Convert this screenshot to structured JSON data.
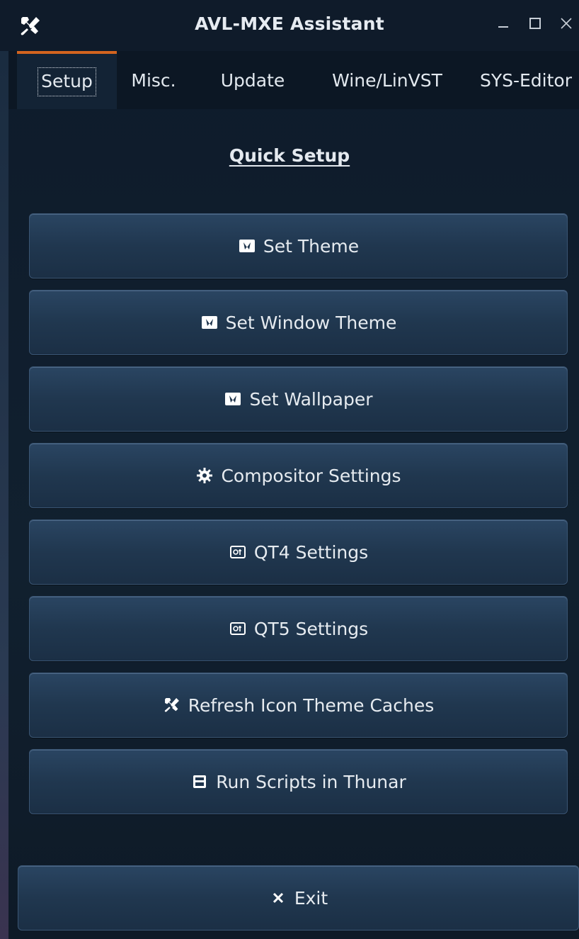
{
  "window": {
    "title": "AVL-MXE Assistant",
    "app_icon": "tools-icon",
    "controls": {
      "minimize_icon": "minimize-icon",
      "maximize_icon": "maximize-icon",
      "close_icon": "close-icon"
    }
  },
  "tabs": [
    {
      "label": "Setup",
      "active": true
    },
    {
      "label": "Misc.",
      "active": false
    },
    {
      "label": "Update",
      "active": false
    },
    {
      "label": "Wine/LinVST",
      "active": false
    },
    {
      "label": "SYS-Editor",
      "active": false
    }
  ],
  "main": {
    "section_title": "Quick Setup",
    "buttons": [
      {
        "label": "Set Theme",
        "icon": "theme-icon"
      },
      {
        "label": "Set Window Theme",
        "icon": "theme-icon"
      },
      {
        "label": "Set Wallpaper",
        "icon": "theme-icon"
      },
      {
        "label": "Compositor Settings",
        "icon": "gear-icon"
      },
      {
        "label": "QT4 Settings",
        "icon": "qt-icon"
      },
      {
        "label": "QT5 Settings",
        "icon": "qt-icon"
      },
      {
        "label": "Refresh Icon Theme Caches",
        "icon": "tools-icon"
      },
      {
        "label": "Run Scripts in Thunar",
        "icon": "script-icon"
      }
    ],
    "exit": {
      "label": "Exit",
      "icon": "close-icon"
    }
  },
  "colors": {
    "background": "#0f1b2a",
    "button": "#20374f",
    "button_border": "#3a5573",
    "active_tab_accent": "#d3641f",
    "text": "#e6ebf0"
  }
}
